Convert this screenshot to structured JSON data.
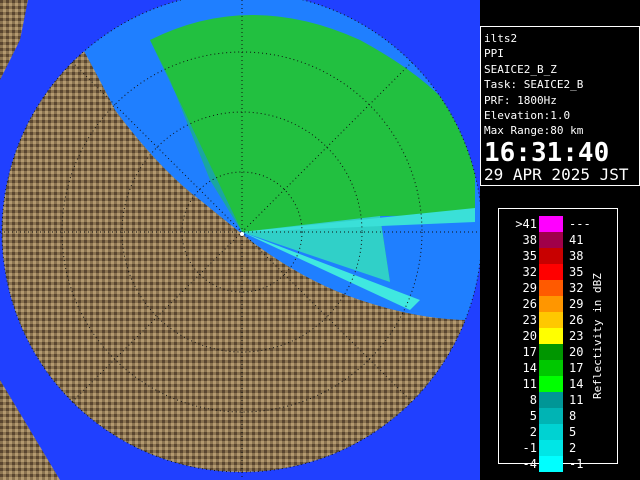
{
  "info": {
    "lines": [
      "ilts2",
      "PPI",
      "SEAICE2_B_Z",
      "Task: SEAICE2_B",
      "PRF: 1800Hz",
      "Elevation:1.0",
      "Max Range:80 km"
    ],
    "time": "16:31:40",
    "date": "29 APR 2025 JST"
  },
  "legend": {
    "title": "Reflectivity in dBZ",
    "rows": [
      {
        "lo": ">41",
        "hi": "---",
        "color": "#ff00ff"
      },
      {
        "lo": "38",
        "hi": "41",
        "color": "#a0004a"
      },
      {
        "lo": "35",
        "hi": "38",
        "color": "#c80000"
      },
      {
        "lo": "32",
        "hi": "35",
        "color": "#ff0000"
      },
      {
        "lo": "29",
        "hi": "32",
        "color": "#ff5a00"
      },
      {
        "lo": "26",
        "hi": "29",
        "color": "#ff9600"
      },
      {
        "lo": "23",
        "hi": "26",
        "color": "#ffc800"
      },
      {
        "lo": "20",
        "hi": "23",
        "color": "#ffff00"
      },
      {
        "lo": "17",
        "hi": "20",
        "color": "#009600"
      },
      {
        "lo": "14",
        "hi": "17",
        "color": "#00c800"
      },
      {
        "lo": "11",
        "hi": "14",
        "color": "#00ff00"
      },
      {
        "lo": "8",
        "hi": "11",
        "color": "#009696"
      },
      {
        "lo": "5",
        "hi": "8",
        "color": "#00b4b4"
      },
      {
        "lo": "2",
        "hi": "5",
        "color": "#00d2d2"
      },
      {
        "lo": "-1",
        "hi": "2",
        "color": "#00e6e6"
      },
      {
        "lo": "-4",
        "hi": "-1",
        "color": "#00ffff"
      }
    ]
  }
}
